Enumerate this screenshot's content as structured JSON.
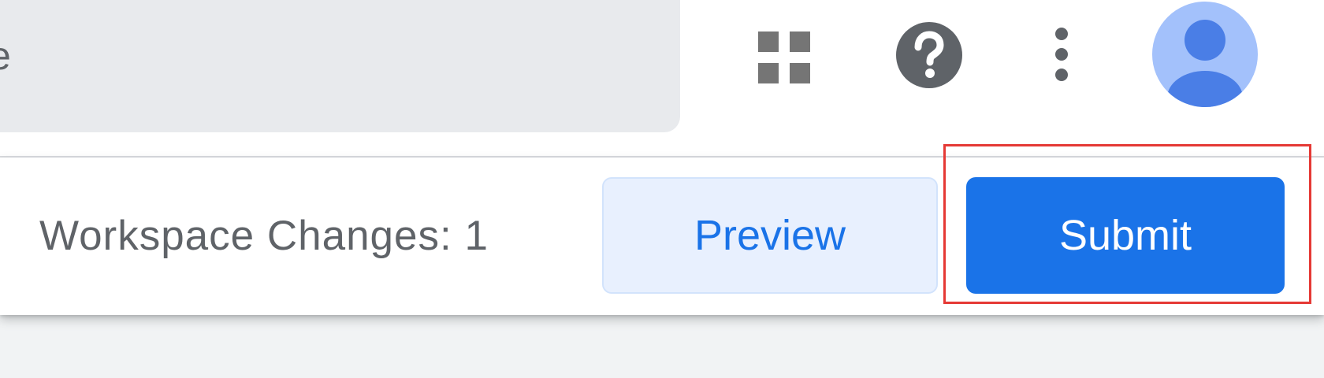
{
  "header": {
    "search_text": "e",
    "icons": {
      "apps": "apps-grid-icon",
      "help": "help-icon",
      "more": "more-vert-icon",
      "avatar": "account-avatar-icon"
    }
  },
  "action_bar": {
    "changes_label": "Workspace Changes: 1",
    "preview_label": "Preview",
    "submit_label": "Submit"
  },
  "colors": {
    "primary": "#1a73e8",
    "preview_bg": "#e8f0fe",
    "text_secondary": "#5f6368",
    "highlight": "#e53935"
  }
}
